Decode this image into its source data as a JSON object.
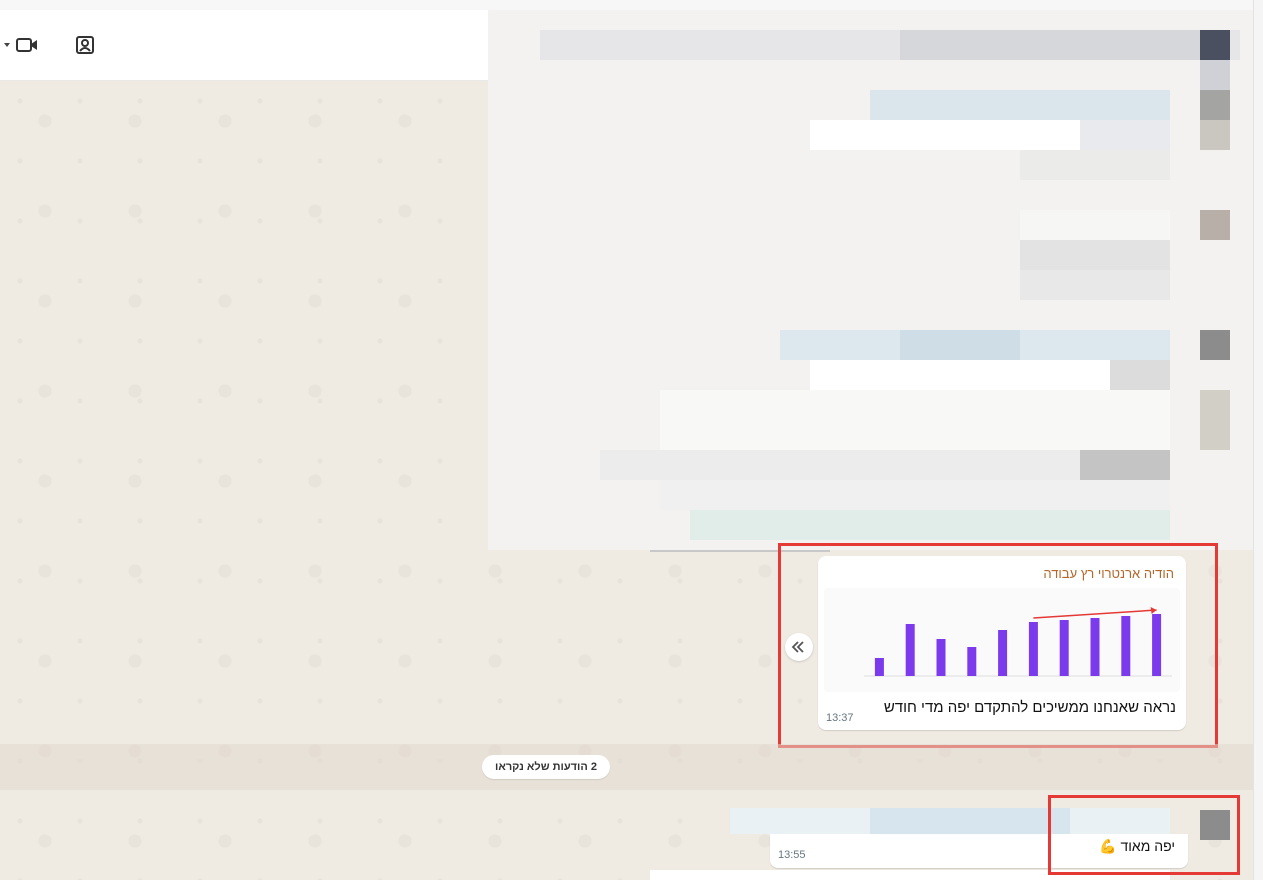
{
  "header": {
    "icons": [
      "video-call-icon",
      "contact-card-icon"
    ]
  },
  "messages": {
    "forwarded": {
      "sender": "הודיה ארנטרוי רץ עבודה",
      "caption": "נראה שאנחנו ממשיכים להתקדם יפה מדי חודש",
      "time": "13:37"
    },
    "reply": {
      "text": "יפה מאוד 💪",
      "time": "13:55"
    }
  },
  "unread": {
    "label": "2 הודעות שלא נקראו"
  },
  "chart_data": {
    "type": "bar",
    "values": [
      18,
      52,
      37,
      29,
      46,
      54,
      56,
      58,
      60,
      62
    ],
    "colors": {
      "bar": "#7c3aed",
      "trend": "#e53935"
    }
  }
}
